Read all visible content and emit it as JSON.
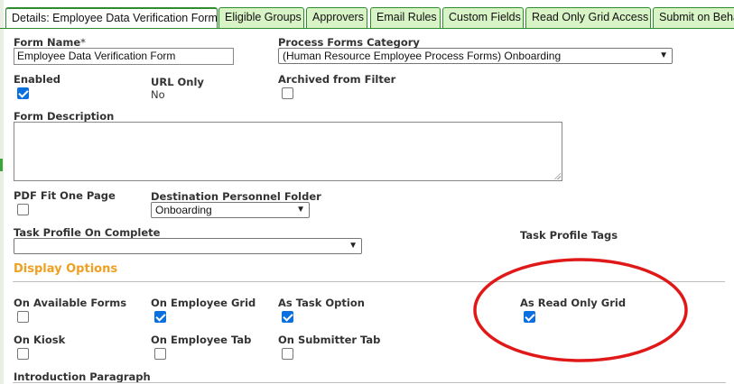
{
  "tabs": [
    {
      "label": "Details: Employee Data Verification Form",
      "active": true
    },
    {
      "label": "Eligible Groups",
      "active": false
    },
    {
      "label": "Approvers",
      "active": false
    },
    {
      "label": "Email Rules",
      "active": false
    },
    {
      "label": "Custom Fields",
      "active": false
    },
    {
      "label": "Read Only Grid Access",
      "active": false
    },
    {
      "label": "Submit on Beha",
      "active": false
    }
  ],
  "form": {
    "form_name_label": "Form Name",
    "required_marker": "*",
    "form_name_value": "Employee Data Verification Form",
    "process_category_label": "Process Forms Category",
    "process_category_value": "(Human Resource Employee Process Forms) Onboarding",
    "enabled_label": "Enabled",
    "enabled_checked": true,
    "url_only_label": "URL Only",
    "url_only_value": "No",
    "archived_label": "Archived from Filter",
    "archived_checked": false,
    "description_label": "Form Description",
    "description_value": "",
    "pdf_fit_label": "PDF Fit One Page",
    "pdf_fit_checked": false,
    "destination_folder_label": "Destination Personnel Folder",
    "destination_folder_value": "Onboarding",
    "task_profile_label": "Task Profile On Complete",
    "task_profile_value": "",
    "task_profile_tags_label": "Task Profile Tags"
  },
  "display_options": {
    "title": "Display Options",
    "on_available_forms": {
      "label": "On Available Forms",
      "checked": false
    },
    "on_employee_grid": {
      "label": "On Employee Grid",
      "checked": true
    },
    "as_task_option": {
      "label": "As Task Option",
      "checked": true
    },
    "as_read_only_grid": {
      "label": "As Read Only Grid",
      "checked": true
    },
    "on_kiosk": {
      "label": "On Kiosk",
      "checked": false
    },
    "on_employee_tab": {
      "label": "On Employee Tab",
      "checked": false
    },
    "on_submitter_tab": {
      "label": "On Submitter Tab",
      "checked": false
    }
  },
  "introduction_label": "Introduction Paragraph",
  "colors": {
    "tab_bg": "#d8f3c5",
    "tab_border": "#2e8b2e",
    "section_title": "#f0a020",
    "checkbox_checked": "#0a70e0",
    "annotation_circle": "#e01818"
  },
  "icons": {
    "dropdown": "chevron-down-icon",
    "checkmark": "checkmark-icon"
  }
}
